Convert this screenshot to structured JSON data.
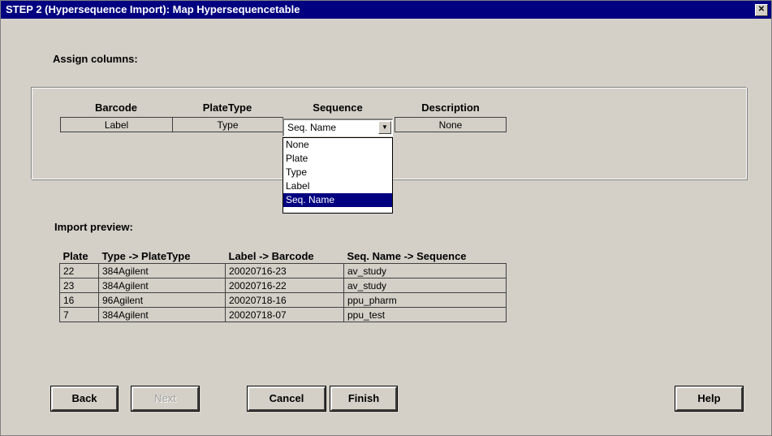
{
  "window": {
    "title": "STEP 2 (Hypersequence Import):  Map Hypersequencetable",
    "close_glyph": "✕"
  },
  "assign": {
    "label": "Assign columns:",
    "columns": [
      {
        "header": "Barcode",
        "value": "Label"
      },
      {
        "header": "PlateType",
        "value": "Type"
      },
      {
        "header": "Sequence",
        "value": "Seq. Name"
      },
      {
        "header": "Description",
        "value": "None"
      }
    ],
    "dropdown_options": [
      "None",
      "Plate",
      "Type",
      "Label",
      "Seq. Name"
    ],
    "dropdown_selected": "Seq. Name"
  },
  "preview": {
    "label": "Import preview:",
    "headers": [
      "Plate",
      "Type -> PlateType",
      "Label -> Barcode",
      "Seq. Name -> Sequence"
    ],
    "rows": [
      [
        "22",
        "384Agilent",
        "20020716-23",
        "av_study"
      ],
      [
        "23",
        "384Agilent",
        "20020716-22",
        "av_study"
      ],
      [
        "16",
        "96Agilent",
        "20020718-16",
        "ppu_pharm"
      ],
      [
        "7",
        "384Agilent",
        "20020718-07",
        "ppu_test"
      ]
    ]
  },
  "buttons": {
    "back": "Back",
    "next": "Next",
    "cancel": "Cancel",
    "finish": "Finish",
    "help": "Help"
  }
}
